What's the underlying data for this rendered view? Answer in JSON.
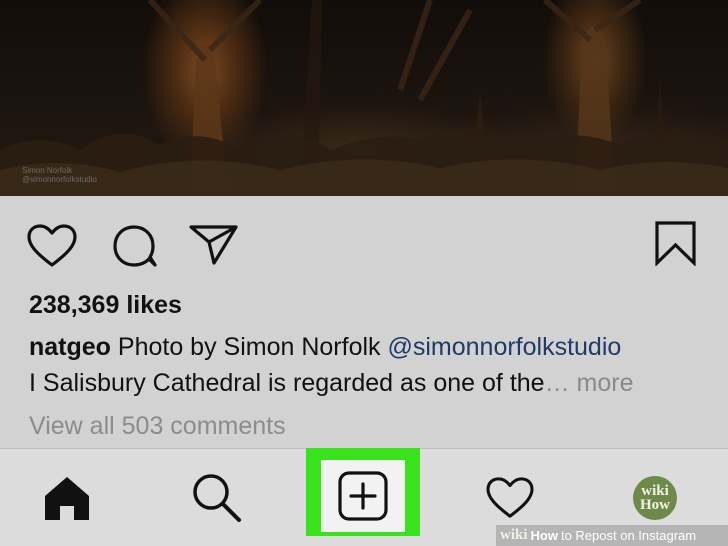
{
  "photo": {
    "credit_line1": "Simon Norfolk",
    "credit_line2": "@simonnorfolkstudio"
  },
  "actions": {
    "like_icon": "heart-outline-icon",
    "comment_icon": "comment-bubble-icon",
    "share_icon": "paper-plane-icon",
    "save_icon": "bookmark-icon"
  },
  "post": {
    "likes": "238,369 likes",
    "username": "natgeo",
    "caption_text": " Photo by Simon Norfolk ",
    "mention": "@simonnorfolkstudio",
    "caption_line2": "I Salisbury Cathedral is regarded as one of the",
    "ellipsis": "…",
    "more_label": " more",
    "view_comments": "View all 503 comments"
  },
  "nav": {
    "items": [
      {
        "name": "home",
        "icon": "home-icon"
      },
      {
        "name": "search",
        "icon": "search-icon"
      },
      {
        "name": "add",
        "icon": "add-post-icon",
        "highlight_color": "#39e21b"
      },
      {
        "name": "activity",
        "icon": "heart-outline-icon"
      },
      {
        "name": "profile",
        "icon": "avatar",
        "avatar_line1": "wiki",
        "avatar_line2": "How"
      }
    ]
  },
  "watermark": {
    "wiki": "wiki",
    "how": "How",
    "rest": "to Repost on Instagram"
  },
  "colors": {
    "background": "#d2d2d2",
    "mention": "#1f3b66",
    "highlight": "#39e21b"
  }
}
